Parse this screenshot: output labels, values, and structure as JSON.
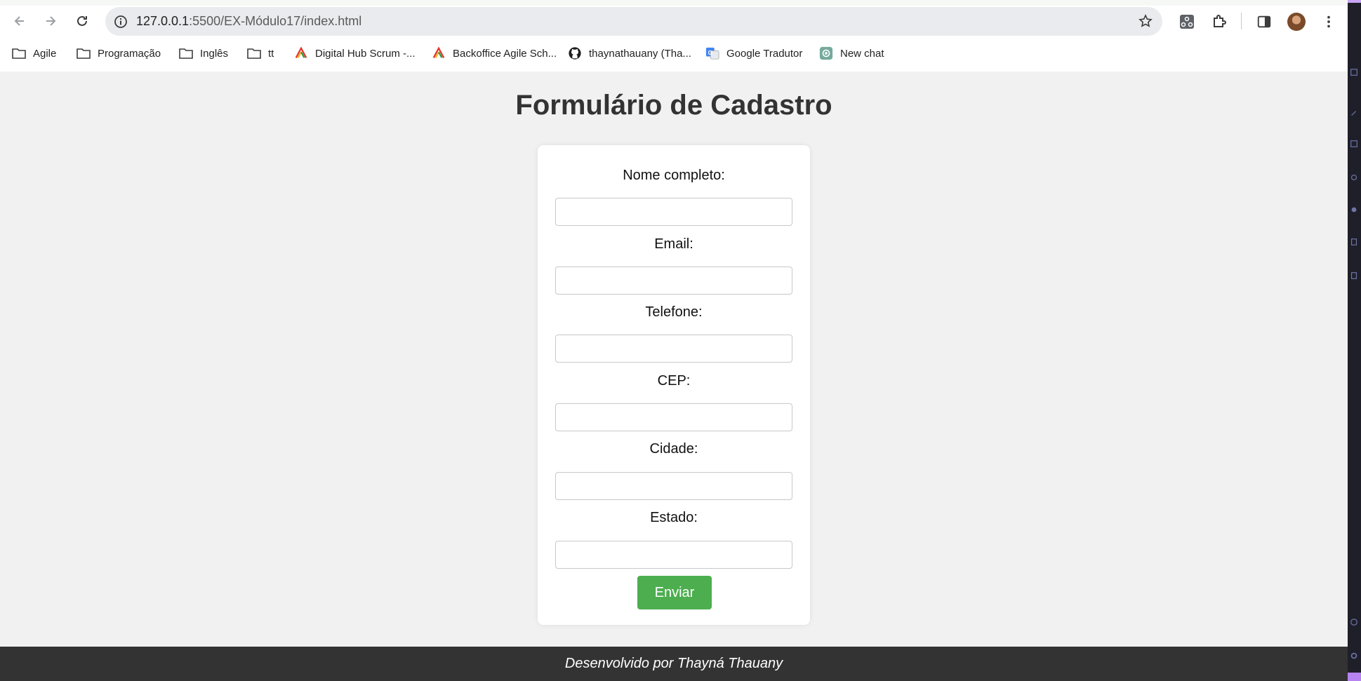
{
  "browser": {
    "url_host": "127.0.0.1",
    "url_path": ":5500/EX-Módulo17/index.html"
  },
  "bookmarks": [
    {
      "label": "Agile",
      "icon": "folder-icon"
    },
    {
      "label": "Programação",
      "icon": "folder-icon"
    },
    {
      "label": "Inglês",
      "icon": "folder-icon"
    },
    {
      "label": "tt",
      "icon": "folder-icon"
    },
    {
      "label": "Digital Hub Scrum -...",
      "icon": "agile-logo-icon"
    },
    {
      "label": "Backoffice Agile Sch...",
      "icon": "agile-logo-icon"
    },
    {
      "label": "thaynathauany (Tha...",
      "icon": "github-icon"
    },
    {
      "label": "Google Tradutor",
      "icon": "google-translate-icon"
    },
    {
      "label": "New chat",
      "icon": "chatgpt-icon"
    }
  ],
  "page": {
    "title": "Formulário de Cadastro",
    "form": {
      "fields": [
        {
          "label": "Nome completo:",
          "value": ""
        },
        {
          "label": "Email:",
          "value": ""
        },
        {
          "label": "Telefone:",
          "value": ""
        },
        {
          "label": "CEP:",
          "value": ""
        },
        {
          "label": "Cidade:",
          "value": ""
        },
        {
          "label": "Estado:",
          "value": ""
        }
      ],
      "submit_label": "Enviar"
    },
    "footer": "Desenvolvido por Thayná Thauany"
  },
  "colors": {
    "submit_button": "#4cae4f",
    "footer_bg": "#333333",
    "page_bg": "#f1f1f1"
  }
}
